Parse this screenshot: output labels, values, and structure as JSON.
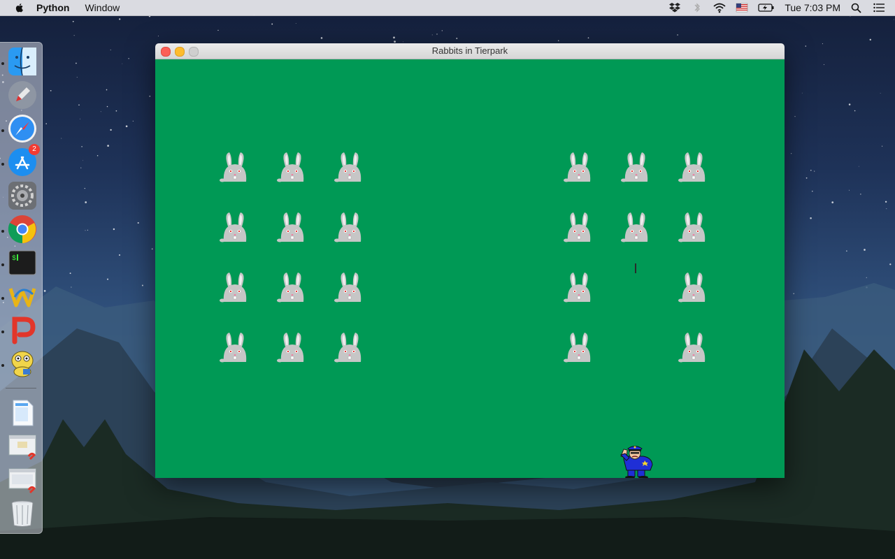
{
  "menubar": {
    "app_name": "Python",
    "menus": [
      "Window"
    ],
    "clock": "Tue 7:03 PM",
    "status_icons": [
      "dropbox-icon",
      "bluetooth-icon",
      "wifi-icon",
      "flag-icon",
      "battery-icon",
      "spotlight-icon",
      "notification-center-icon"
    ]
  },
  "dock": {
    "items": [
      {
        "name": "finder",
        "running": true
      },
      {
        "name": "launchpad",
        "running": false
      },
      {
        "name": "safari",
        "running": true
      },
      {
        "name": "app-store",
        "running": true,
        "badge": "2"
      },
      {
        "name": "system-preferences",
        "running": false
      },
      {
        "name": "chrome",
        "running": true
      },
      {
        "name": "terminal",
        "running": true
      },
      {
        "name": "editor",
        "running": true
      },
      {
        "name": "powerpoint",
        "running": true
      },
      {
        "name": "python-launcher",
        "running": true
      },
      {
        "name": "documents",
        "running": false
      },
      {
        "name": "recent-1",
        "running": false
      },
      {
        "name": "recent-2",
        "running": false
      },
      {
        "name": "trash",
        "running": false
      }
    ]
  },
  "window": {
    "title": "Rabbits in Tierpark"
  },
  "game": {
    "background": "#009955",
    "left_group": {
      "rows": 4,
      "cols": 3,
      "present": [
        [
          1,
          1,
          1
        ],
        [
          1,
          1,
          1
        ],
        [
          1,
          1,
          1
        ],
        [
          1,
          1,
          1
        ]
      ]
    },
    "right_group": {
      "rows": 4,
      "cols": 3,
      "present": [
        [
          1,
          1,
          1
        ],
        [
          1,
          1,
          1
        ],
        [
          1,
          0,
          1
        ],
        [
          1,
          0,
          1
        ]
      ]
    },
    "player": "police-officer",
    "projectile": "bullet"
  }
}
